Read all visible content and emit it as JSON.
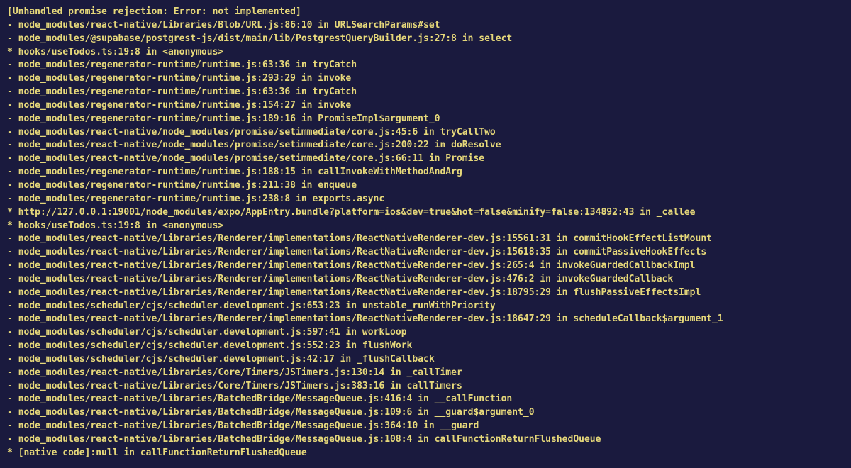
{
  "error_header": "[Unhandled promise rejection: Error: not implemented]",
  "stack_trace": [
    "- node_modules/react-native/Libraries/Blob/URL.js:86:10 in URLSearchParams#set",
    "- node_modules/@supabase/postgrest-js/dist/main/lib/PostgrestQueryBuilder.js:27:8 in select",
    "* hooks/useTodos.ts:19:8 in <anonymous>",
    "- node_modules/regenerator-runtime/runtime.js:63:36 in tryCatch",
    "- node_modules/regenerator-runtime/runtime.js:293:29 in invoke",
    "- node_modules/regenerator-runtime/runtime.js:63:36 in tryCatch",
    "- node_modules/regenerator-runtime/runtime.js:154:27 in invoke",
    "- node_modules/regenerator-runtime/runtime.js:189:16 in PromiseImpl$argument_0",
    "- node_modules/react-native/node_modules/promise/setimmediate/core.js:45:6 in tryCallTwo",
    "- node_modules/react-native/node_modules/promise/setimmediate/core.js:200:22 in doResolve",
    "- node_modules/react-native/node_modules/promise/setimmediate/core.js:66:11 in Promise",
    "- node_modules/regenerator-runtime/runtime.js:188:15 in callInvokeWithMethodAndArg",
    "- node_modules/regenerator-runtime/runtime.js:211:38 in enqueue",
    "- node_modules/regenerator-runtime/runtime.js:238:8 in exports.async",
    "* http://127.0.0.1:19001/node_modules/expo/AppEntry.bundle?platform=ios&dev=true&hot=false&minify=false:134892:43 in _callee",
    "* hooks/useTodos.ts:19:8 in <anonymous>",
    "- node_modules/react-native/Libraries/Renderer/implementations/ReactNativeRenderer-dev.js:15561:31 in commitHookEffectListMount",
    "- node_modules/react-native/Libraries/Renderer/implementations/ReactNativeRenderer-dev.js:15618:35 in commitPassiveHookEffects",
    "- node_modules/react-native/Libraries/Renderer/implementations/ReactNativeRenderer-dev.js:265:4 in invokeGuardedCallbackImpl",
    "- node_modules/react-native/Libraries/Renderer/implementations/ReactNativeRenderer-dev.js:476:2 in invokeGuardedCallback",
    "- node_modules/react-native/Libraries/Renderer/implementations/ReactNativeRenderer-dev.js:18795:29 in flushPassiveEffectsImpl",
    "- node_modules/scheduler/cjs/scheduler.development.js:653:23 in unstable_runWithPriority",
    "- node_modules/react-native/Libraries/Renderer/implementations/ReactNativeRenderer-dev.js:18647:29 in scheduleCallback$argument_1",
    "- node_modules/scheduler/cjs/scheduler.development.js:597:41 in workLoop",
    "- node_modules/scheduler/cjs/scheduler.development.js:552:23 in flushWork",
    "- node_modules/scheduler/cjs/scheduler.development.js:42:17 in _flushCallback",
    "- node_modules/react-native/Libraries/Core/Timers/JSTimers.js:130:14 in _callTimer",
    "- node_modules/react-native/Libraries/Core/Timers/JSTimers.js:383:16 in callTimers",
    "- node_modules/react-native/Libraries/BatchedBridge/MessageQueue.js:416:4 in __callFunction",
    "- node_modules/react-native/Libraries/BatchedBridge/MessageQueue.js:109:6 in __guard$argument_0",
    "- node_modules/react-native/Libraries/BatchedBridge/MessageQueue.js:364:10 in __guard",
    "- node_modules/react-native/Libraries/BatchedBridge/MessageQueue.js:108:4 in callFunctionReturnFlushedQueue",
    "* [native code]:null in callFunctionReturnFlushedQueue"
  ]
}
